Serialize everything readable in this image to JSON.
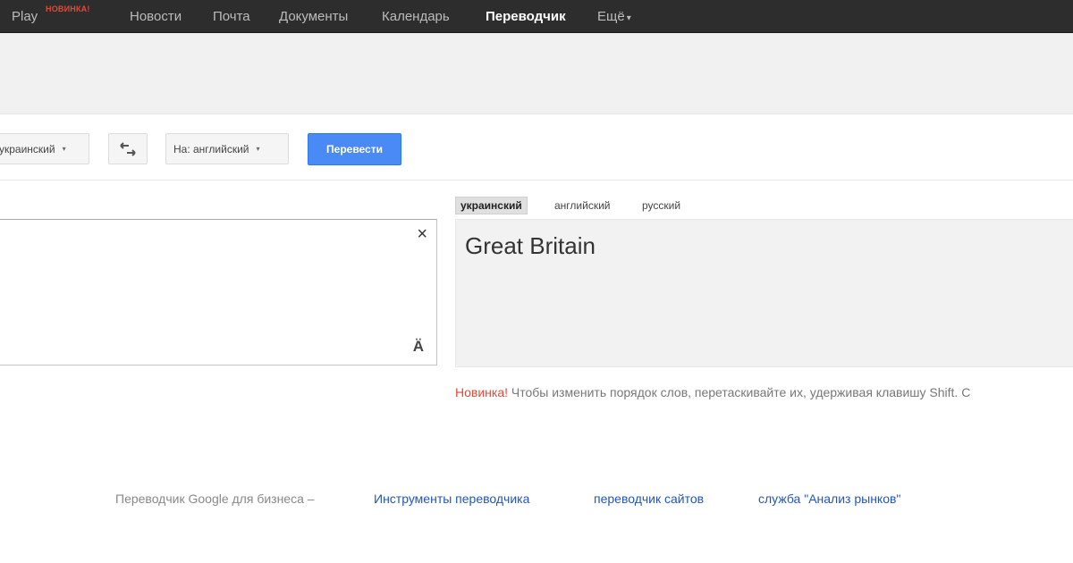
{
  "topnav": {
    "items": [
      {
        "label": "Play",
        "badge": "НОВИНКА!"
      },
      {
        "label": "Новости"
      },
      {
        "label": "Почта"
      },
      {
        "label": "Документы"
      },
      {
        "label": "Календарь"
      },
      {
        "label": "Переводчик",
        "active": true
      }
    ],
    "more_label": "Ещё",
    "more_caret": "▾"
  },
  "toolbar": {
    "source_lang": "украинский",
    "target_lang": "На: английский",
    "dropdown_caret": "▾",
    "swap_icon": "swap-languages-icon",
    "translate_label": "Перевести"
  },
  "source": {
    "value": "",
    "clear_icon": "×",
    "ime_icon": "Ä"
  },
  "result": {
    "tabs": [
      "украинский",
      "английский",
      "русский"
    ],
    "selected_tab": 0,
    "text": "Great Britain"
  },
  "notice": {
    "new_label": "Новинка!",
    "text": " Чтобы изменить порядок слов, перетаскивайте их, удерживая клавишу Shift. С"
  },
  "footer": {
    "prefix": "Переводчик Google для бизнеса –",
    "links": [
      "Инструменты переводчика",
      "переводчик сайтов",
      "служба \"Анализ рынков\""
    ]
  },
  "colors": {
    "topbar": "#2d2d2d",
    "accent_blue": "#4a8af4",
    "new_red": "#dd4b39",
    "link_blue": "#2255bb"
  }
}
